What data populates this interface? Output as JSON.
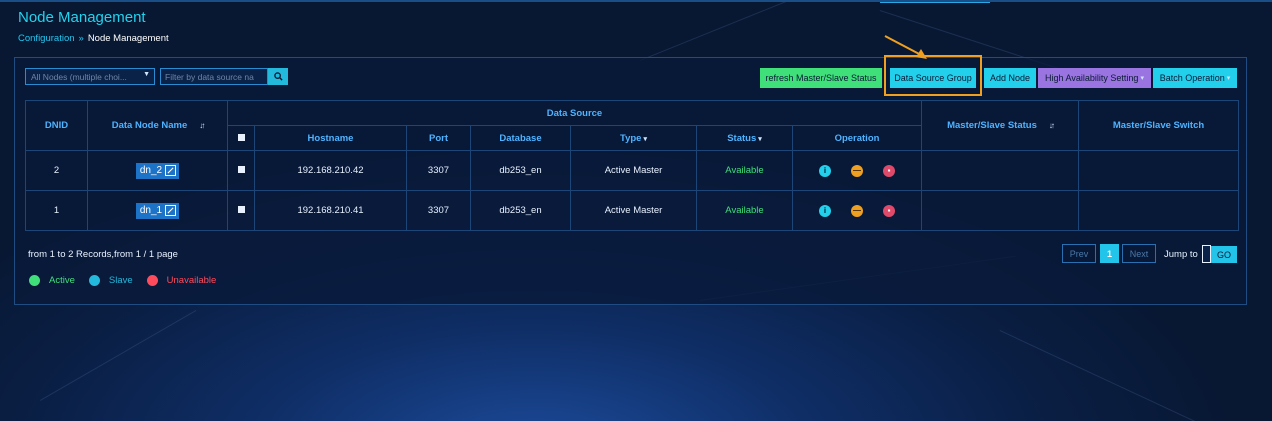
{
  "header": {
    "title": "Node Management",
    "breadcrumb": [
      "Configuration",
      "»",
      "Node Management"
    ]
  },
  "filters": {
    "nodes_select": "All Nodes (multiple choi...",
    "search_placeholder": "Filter by data source na"
  },
  "toolbar": {
    "refresh": "refresh Master/Slave Status",
    "data_source_group": "Data Source Group",
    "add_node": "Add Node",
    "high_availability": "High Availability Setting",
    "batch_operation": "Batch Operation"
  },
  "table": {
    "headers": {
      "dnid": "DNID",
      "node_name": "Data Node Name",
      "data_source": "Data Source",
      "hostname": "Hostname",
      "port": "Port",
      "database": "Database",
      "type": "Type",
      "status": "Status",
      "operation": "Operation",
      "ms_status": "Master/Slave Status",
      "ms_switch": "Master/Slave Switch"
    },
    "rows": [
      {
        "dnid": "2",
        "name": "dn_2",
        "hostname": "192.168.210.42",
        "port": "3307",
        "database": "db253_en",
        "type": "Active Master",
        "status": "Available",
        "ms_status": "",
        "ms_switch": ""
      },
      {
        "dnid": "1",
        "name": "dn_1",
        "hostname": "192.168.210.41",
        "port": "3307",
        "database": "db253_en",
        "type": "Active Master",
        "status": "Available",
        "ms_status": "",
        "ms_switch": ""
      }
    ]
  },
  "footer": {
    "records": "from 1 to 2 Records,from 1 / 1 page",
    "prev": "Prev",
    "current_page": "1",
    "next": "Next",
    "jump_to": "Jump to",
    "go": "GO"
  },
  "legend": [
    {
      "label": "Active",
      "color": "#3fe07a"
    },
    {
      "label": "Slave",
      "color": "#22b9dc"
    },
    {
      "label": "Unavailable",
      "color": "#ff4b5c"
    }
  ],
  "colors": {
    "accent": "#22d0ec",
    "success": "#3fe07a",
    "highlight": "#f0a020"
  }
}
